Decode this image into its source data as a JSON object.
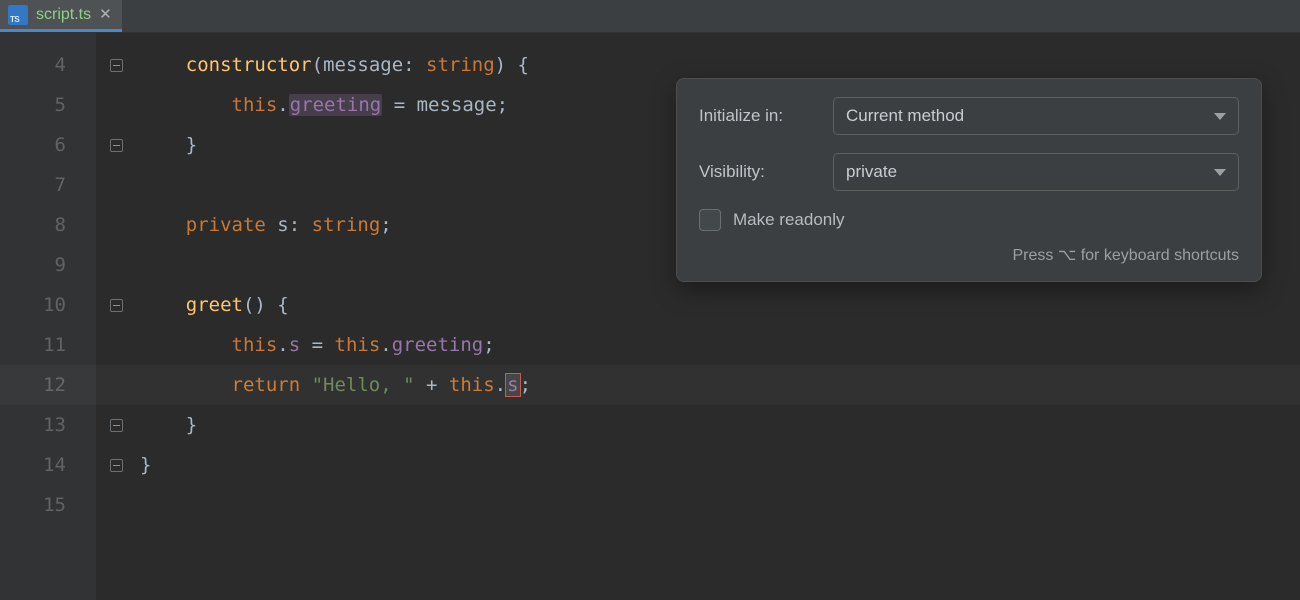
{
  "tab": {
    "filename": "script.ts",
    "icon_label": "TS"
  },
  "gutter": {
    "start": 4,
    "end": 15
  },
  "code": {
    "l4": {
      "kw": "constructor",
      "prm": "message",
      "typ": "string"
    },
    "l5": {
      "ths": "this",
      "prop": "greeting",
      "id": "message"
    },
    "l8": {
      "mod": "private",
      "name": "s",
      "typ": "string"
    },
    "l10": {
      "fn": "greet"
    },
    "l11": {
      "ths1": "this",
      "p1": "s",
      "ths2": "this",
      "p2": "greeting"
    },
    "l12": {
      "kw": "return",
      "str": "\"Hello, \"",
      "ths": "this",
      "p": "s"
    }
  },
  "popup": {
    "labels": {
      "initialize": "Initialize in:",
      "visibility": "Visibility:",
      "readonly": "Make readonly"
    },
    "values": {
      "initialize": "Current method",
      "visibility": "private"
    },
    "hint_prefix": "Press ",
    "hint_key": "⌥",
    "hint_suffix": " for keyboard shortcuts"
  }
}
